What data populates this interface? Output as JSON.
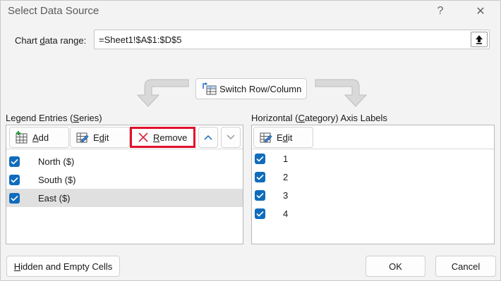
{
  "window": {
    "title": "Select Data Source",
    "help_symbol": "?",
    "close_symbol": "✕"
  },
  "range": {
    "label": "Chart data range:",
    "value": "=Sheet1!$A$1:$D$5"
  },
  "switch_button": {
    "label": "Switch Row/Column"
  },
  "legend": {
    "label": "Legend Entries (Series)",
    "add_label": "Add",
    "edit_label": "Edit",
    "remove_label": "Remove",
    "series": [
      {
        "label": "North ($)",
        "checked": true,
        "selected": false
      },
      {
        "label": "South ($)",
        "checked": true,
        "selected": false
      },
      {
        "label": "East ($)",
        "checked": true,
        "selected": true
      }
    ]
  },
  "axis": {
    "label": "Horizontal (Category) Axis Labels",
    "edit_label": "Edit",
    "items": [
      {
        "label": "1",
        "checked": true
      },
      {
        "label": "2",
        "checked": true
      },
      {
        "label": "3",
        "checked": true
      },
      {
        "label": "4",
        "checked": true
      }
    ]
  },
  "footer": {
    "hidden_cells_label": "Hidden and Empty Cells",
    "ok_label": "OK",
    "cancel_label": "Cancel"
  },
  "colors": {
    "accent": "#0f6cbd",
    "highlight_border": "#e2102a"
  }
}
